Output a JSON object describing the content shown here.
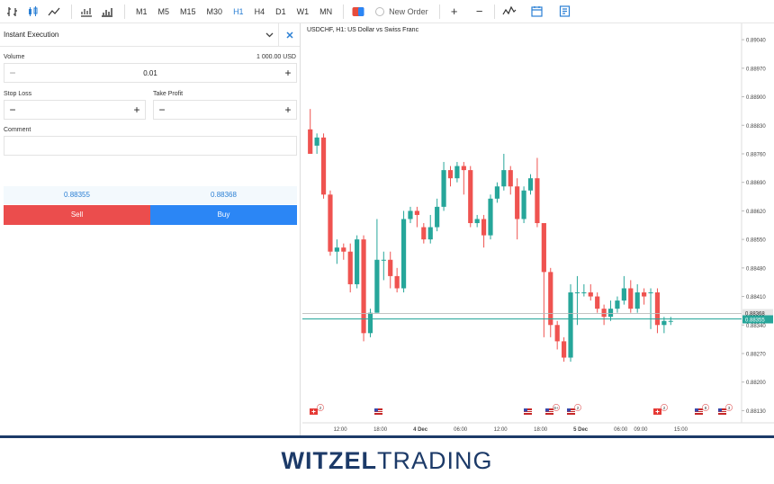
{
  "toolbar": {
    "timeframes": [
      "M1",
      "M5",
      "M15",
      "M30",
      "H1",
      "H4",
      "D1",
      "W1",
      "MN"
    ],
    "active_timeframe": "H1",
    "new_order_label": "New Order",
    "zoom_in": "+",
    "zoom_out": "−"
  },
  "order_panel": {
    "title": "Instant Execution",
    "volume_label": "Volume",
    "volume_value": "0.01",
    "volume_usd": "1 000.00 USD",
    "stop_loss_label": "Stop Loss",
    "take_profit_label": "Take Profit",
    "comment_label": "Comment",
    "sell_price": "0.88355",
    "buy_price": "0.88368",
    "sell_label": "Sell",
    "buy_label": "Buy",
    "minus": "−",
    "plus": "+"
  },
  "chart_data": {
    "type": "candlestick",
    "title": "USDCHF, H1: US Dollar vs Swiss Franc",
    "ylim": [
      0.881,
      0.8908
    ],
    "y_ticks": [
      "0.89040",
      "0.88970",
      "0.88900",
      "0.88830",
      "0.88760",
      "0.88690",
      "0.88620",
      "0.88550",
      "0.88480",
      "0.88410",
      "0.88340",
      "0.88270",
      "0.88200",
      "0.88130"
    ],
    "x_ticks": [
      "12:00",
      "18:00",
      "4 Dec",
      "06:00",
      "12:00",
      "18:00",
      "5 Dec",
      "06:00",
      "09:00",
      "15:00"
    ],
    "bid_line": 0.88355,
    "ask_line": 0.88368,
    "bid_label": "0.88355",
    "ask_label": "0.88368",
    "candles": [
      [
        0.8882,
        0.8876,
        0.8887,
        0.8876
      ],
      [
        0.8878,
        0.888,
        0.8881,
        0.8876
      ],
      [
        0.888,
        0.8866,
        0.8881,
        0.8865
      ],
      [
        0.8866,
        0.8852,
        0.8867,
        0.8851
      ],
      [
        0.8852,
        0.8853,
        0.8855,
        0.8849
      ],
      [
        0.8853,
        0.8852,
        0.8854,
        0.885
      ],
      [
        0.8852,
        0.8844,
        0.8854,
        0.8842
      ],
      [
        0.8844,
        0.8855,
        0.8856,
        0.8843
      ],
      [
        0.8855,
        0.8832,
        0.8856,
        0.883
      ],
      [
        0.8832,
        0.8837,
        0.8838,
        0.8831
      ],
      [
        0.8837,
        0.885,
        0.886,
        0.8844
      ],
      [
        0.885,
        0.885,
        0.8852,
        0.8845
      ],
      [
        0.885,
        0.8846,
        0.8852,
        0.8843
      ],
      [
        0.8846,
        0.8843,
        0.8848,
        0.8842
      ],
      [
        0.8843,
        0.886,
        0.8862,
        0.8842
      ],
      [
        0.886,
        0.8862,
        0.8863,
        0.8859
      ],
      [
        0.8862,
        0.8861,
        0.8863,
        0.8858
      ],
      [
        0.8858,
        0.8855,
        0.8859,
        0.8854
      ],
      [
        0.8855,
        0.8858,
        0.8861,
        0.8854
      ],
      [
        0.8858,
        0.8863,
        0.8865,
        0.8857
      ],
      [
        0.8863,
        0.8872,
        0.8874,
        0.8862
      ],
      [
        0.8872,
        0.887,
        0.8873,
        0.8868
      ],
      [
        0.887,
        0.8873,
        0.8874,
        0.8869
      ],
      [
        0.8873,
        0.8872,
        0.8874,
        0.8866
      ],
      [
        0.8872,
        0.8859,
        0.8873,
        0.8858
      ],
      [
        0.8859,
        0.886,
        0.8861,
        0.8858
      ],
      [
        0.886,
        0.8856,
        0.8861,
        0.8853
      ],
      [
        0.8856,
        0.8865,
        0.8866,
        0.8855
      ],
      [
        0.8865,
        0.8868,
        0.8869,
        0.8864
      ],
      [
        0.8868,
        0.8872,
        0.8876,
        0.8867
      ],
      [
        0.8872,
        0.8868,
        0.8873,
        0.8866
      ],
      [
        0.8868,
        0.886,
        0.887,
        0.8855
      ],
      [
        0.886,
        0.8867,
        0.8868,
        0.8859
      ],
      [
        0.8867,
        0.887,
        0.8871,
        0.8866
      ],
      [
        0.887,
        0.8859,
        0.8875,
        0.8858
      ],
      [
        0.8859,
        0.8847,
        0.8856,
        0.8831
      ],
      [
        0.8847,
        0.8834,
        0.8848,
        0.8831
      ],
      [
        0.8834,
        0.883,
        0.8835,
        0.8828
      ],
      [
        0.883,
        0.8826,
        0.8831,
        0.8825
      ],
      [
        0.8826,
        0.8842,
        0.8844,
        0.8825
      ],
      [
        0.8842,
        0.8842,
        0.8846,
        0.8834
      ],
      [
        0.8842,
        0.8842,
        0.8844,
        0.8841
      ],
      [
        0.8842,
        0.8841,
        0.8844,
        0.884
      ],
      [
        0.8841,
        0.8838,
        0.8842,
        0.8837
      ],
      [
        0.8838,
        0.8836,
        0.8839,
        0.8834
      ],
      [
        0.8836,
        0.8838,
        0.884,
        0.8835
      ],
      [
        0.8838,
        0.884,
        0.8841,
        0.8837
      ],
      [
        0.884,
        0.8843,
        0.8846,
        0.8839
      ],
      [
        0.8843,
        0.8838,
        0.8845,
        0.8837
      ],
      [
        0.8838,
        0.8842,
        0.8844,
        0.8837
      ],
      [
        0.8842,
        0.8841,
        0.8843,
        0.8839
      ],
      [
        0.8842,
        0.8842,
        0.8843,
        0.8833
      ],
      [
        0.8842,
        0.8834,
        0.8843,
        0.8832
      ],
      [
        0.8834,
        0.8835,
        0.8836,
        0.8832
      ],
      [
        0.8835,
        0.8835,
        0.8836,
        0.8834
      ]
    ],
    "events": [
      {
        "flag": "ch",
        "count": "2"
      },
      {
        "flag": "us",
        "count": ""
      },
      {
        "flag": "us",
        "count": ""
      },
      {
        "flag": "us",
        "count": "9+"
      },
      {
        "flag": "us",
        "count": "2"
      },
      {
        "flag": "ch",
        "count": "2"
      },
      {
        "flag": "us",
        "count": "8"
      },
      {
        "flag": "us",
        "count": "3"
      }
    ]
  },
  "footer": {
    "logo_bold": "WITZEL",
    "logo_light": "TRADING"
  },
  "colors": {
    "bull": "#26a69a",
    "bear": "#ef5350",
    "accent": "#2a7fd4",
    "brand": "#1c3a68"
  }
}
